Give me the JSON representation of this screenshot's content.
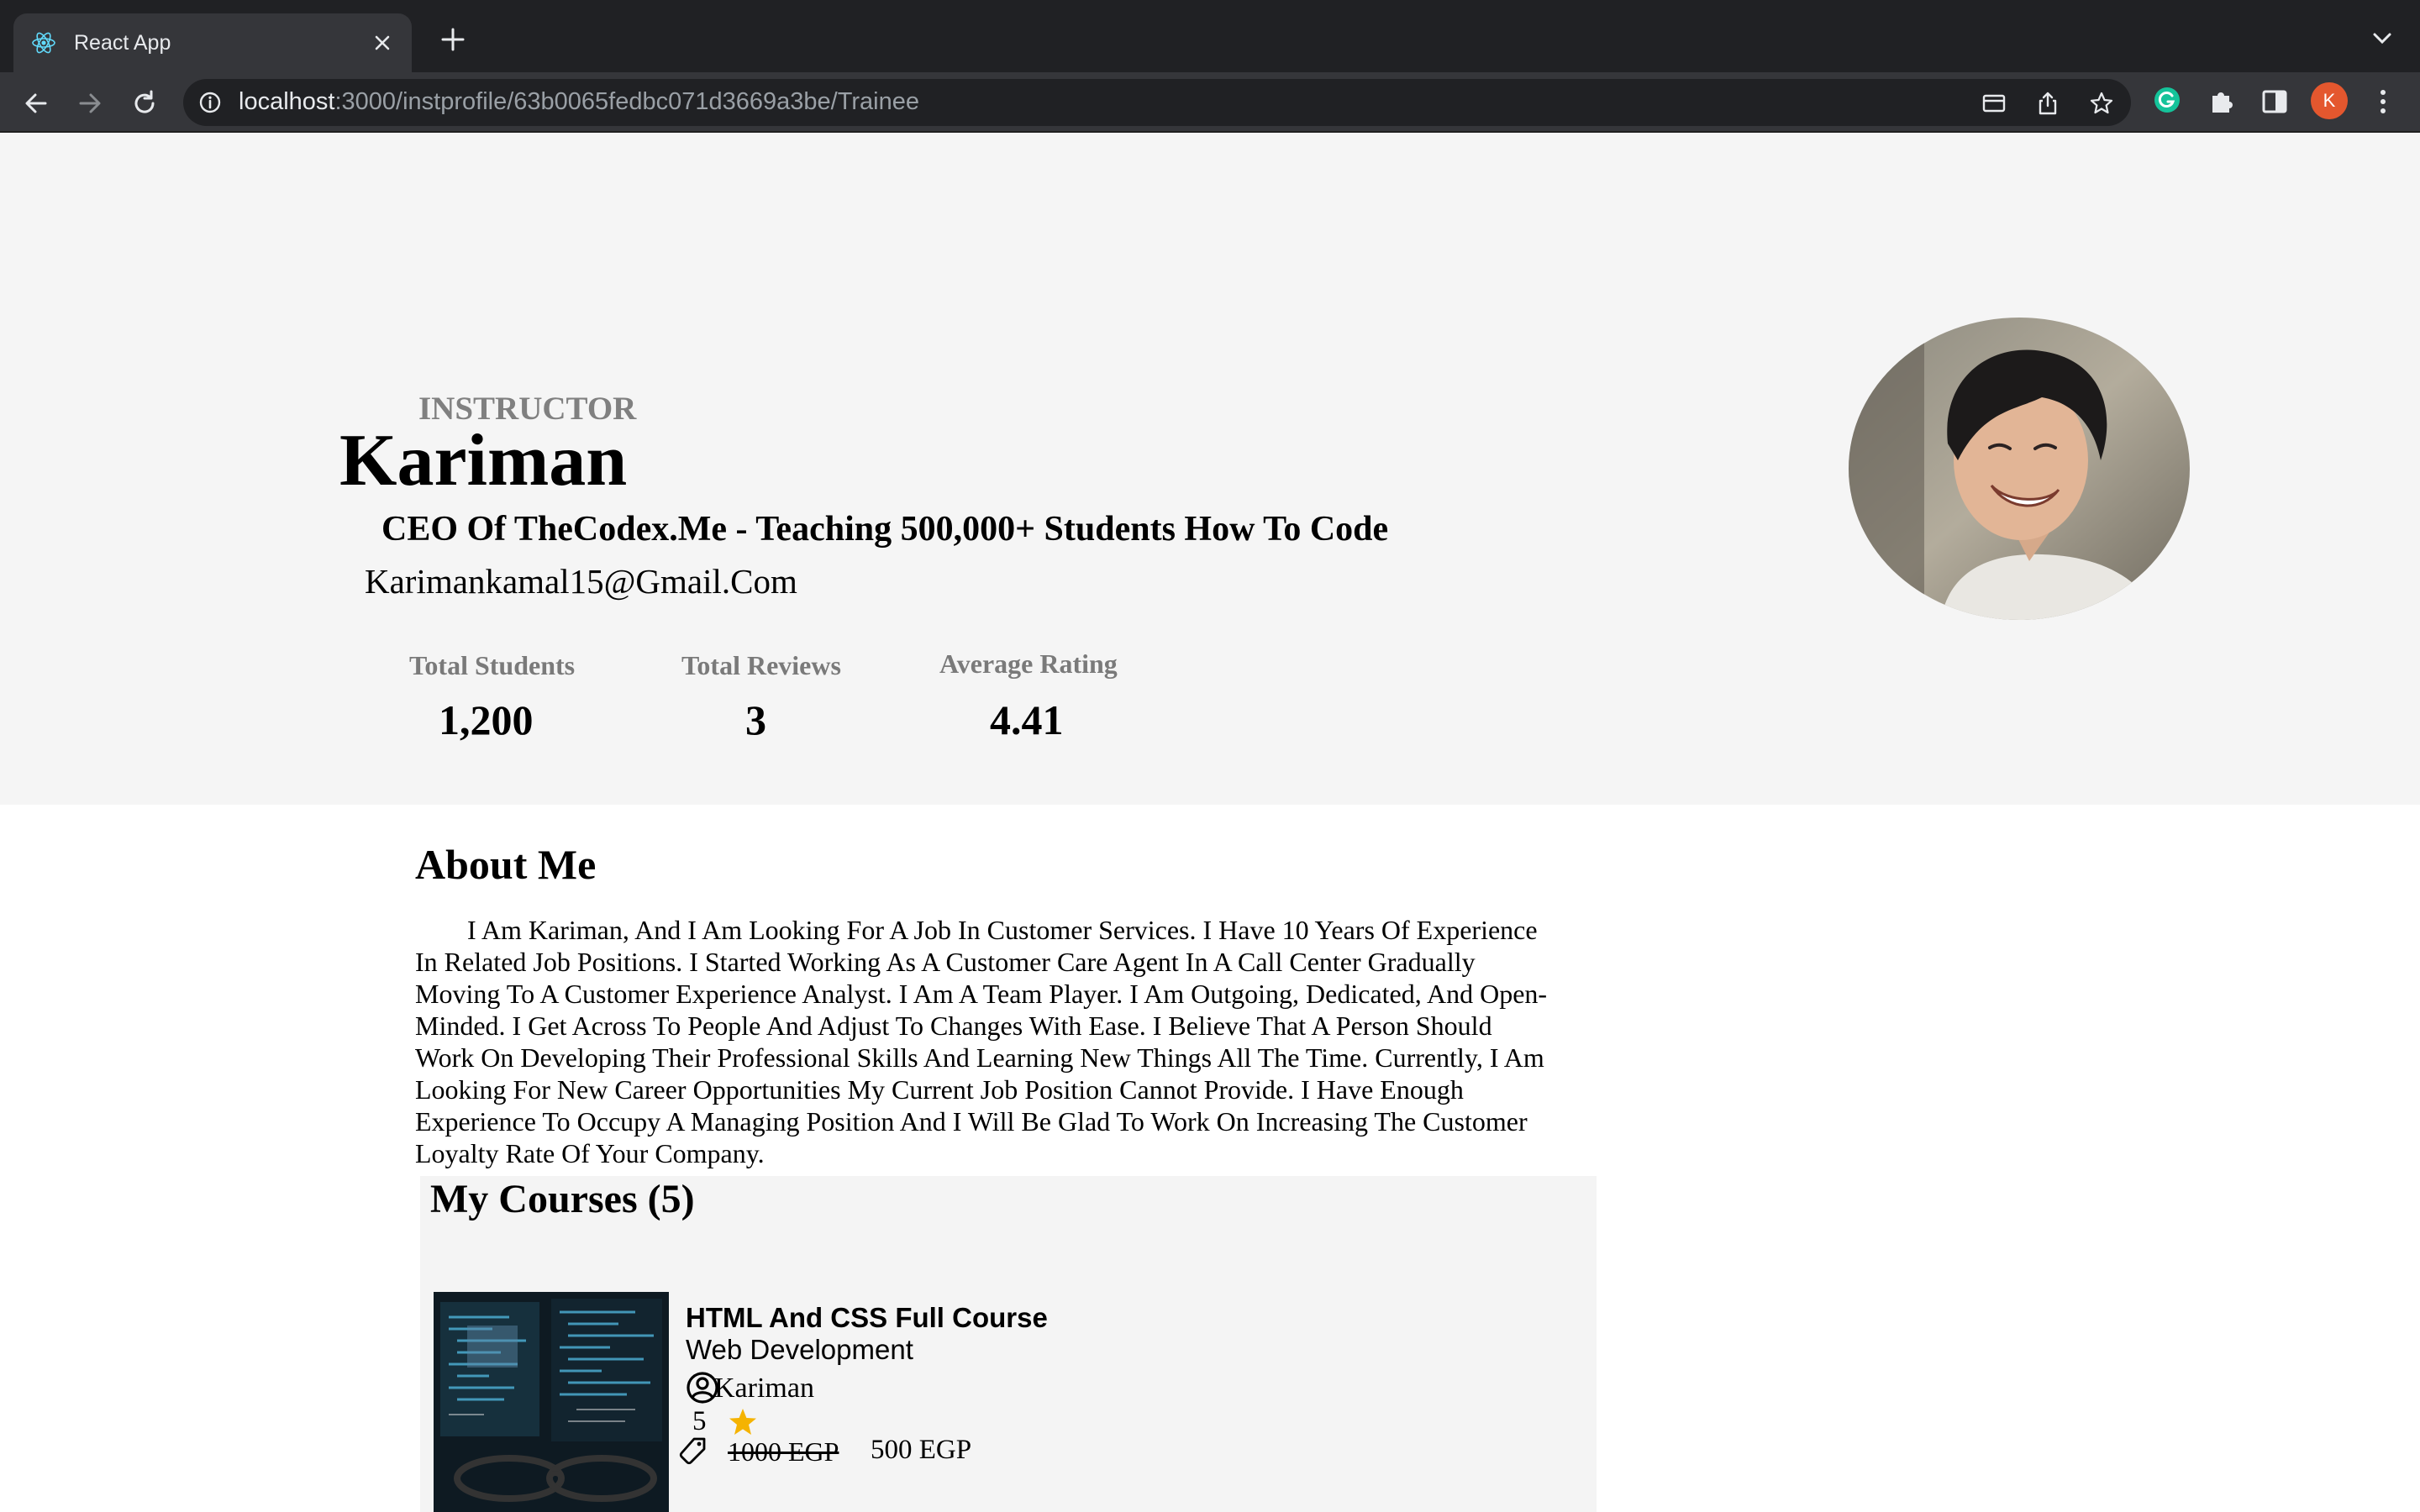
{
  "browser": {
    "tab_title": "React App",
    "url_host": "localhost",
    "url_path": ":3000/instprofile/63b0065fedbc071d3669a3be/Trainee",
    "profile_initial": "K"
  },
  "profile": {
    "role_label": "INSTRUCTOR",
    "name": "Kariman",
    "headline": "CEO Of TheCodex.Me - Teaching 500,000+ Students How To Code",
    "email": "Karimankamal15@Gmail.Com",
    "stats": [
      {
        "label": "Total Students",
        "value": "1,200"
      },
      {
        "label": "Total Reviews",
        "value": "3"
      },
      {
        "label": "Average Rating",
        "value": "4.41"
      }
    ]
  },
  "about": {
    "title": "About Me",
    "text": "I Am Kariman, And I Am Looking For A Job In Customer Services. I Have 10 Years Of Experience In Related Job Positions. I Started Working As A Customer Care Agent In A Call Center Gradually Moving To A Customer Experience Analyst. I Am A Team Player. I Am Outgoing, Dedicated, And Open-Minded. I Get Across To People And Adjust To Changes With Ease. I Believe That A Person Should Work On Developing Their Professional Skills And Learning New Things All The Time. Currently, I Am Looking For New Career Opportunities My Current Job Position Cannot Provide. I Have Enough Experience To Occupy A Managing Position And I Will Be Glad To Work On Increasing The Customer Loyalty Rate Of Your Company."
  },
  "courses": {
    "title": "My Courses (5)",
    "items": [
      {
        "title": "HTML And CSS Full Course",
        "category": "Web Development",
        "instructor": "Kariman",
        "rating": "5",
        "old_price": "1000 EGP",
        "price": "500 EGP"
      }
    ]
  },
  "colors": {
    "hero_background": "#f5f5f5",
    "star": "#f5b301",
    "muted_label": "#808080"
  }
}
